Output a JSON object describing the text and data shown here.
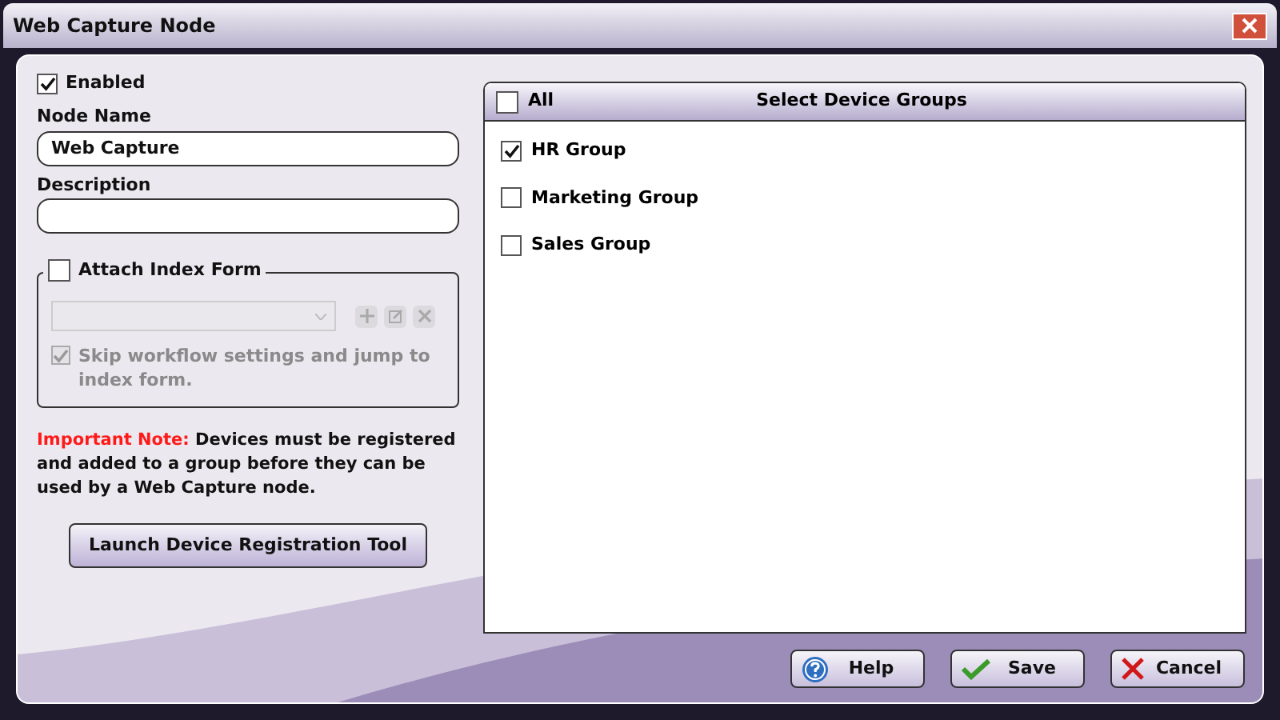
{
  "window": {
    "title": "Web Capture Node"
  },
  "enabled": {
    "label": "Enabled",
    "checked": true
  },
  "node_name": {
    "label": "Node Name",
    "value": "Web Capture"
  },
  "description": {
    "label": "Description"
  },
  "attach_index_form": {
    "label": "Attach Index Form",
    "checked": false,
    "skip": {
      "label": "Skip workflow settings and jump to index form.",
      "checked": true,
      "disabled": true
    }
  },
  "note": {
    "label": "Important Note:",
    "text": "Devices must be registered and added to a group before they can be used by a Web Capture node."
  },
  "launch_button": "Launch Device Registration Tool",
  "device_groups": {
    "title": "Select Device Groups",
    "all": {
      "label": "All",
      "checked": false
    },
    "items": [
      {
        "label": "HR Group",
        "checked": true
      },
      {
        "label": "Marketing Group",
        "checked": false
      },
      {
        "label": "Sales Group",
        "checked": false
      }
    ]
  },
  "buttons": [
    {
      "kind": "help",
      "label": "Help"
    },
    {
      "kind": "save",
      "label": "Save"
    },
    {
      "kind": "cancel",
      "label": "Cancel"
    }
  ]
}
